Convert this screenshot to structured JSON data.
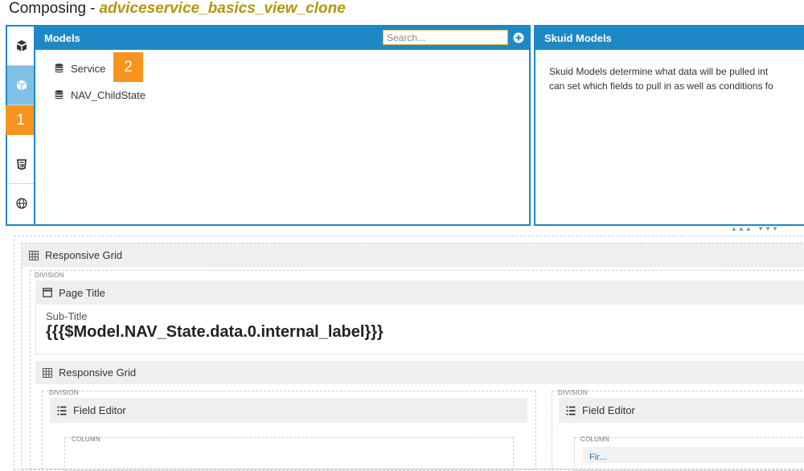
{
  "header": {
    "label": "Composing",
    "separator": "-",
    "page_name": "adviceservice_basics_view_clone"
  },
  "toolbar": {
    "buttons": [
      {
        "icon": "cube-stack-icon",
        "active": false
      },
      {
        "icon": "cube-icon",
        "active": true
      },
      {
        "icon": "css-icon",
        "active": false
      },
      {
        "icon": "globe-icon",
        "active": false
      }
    ],
    "badge_1": "1"
  },
  "models_panel": {
    "title": "Models",
    "search_placeholder": "Search...",
    "badge_2": "2",
    "items": [
      {
        "label": "Service",
        "icon": "database-icon"
      },
      {
        "label": "NAV_ChildState",
        "icon": "database-icon"
      }
    ]
  },
  "info_panel": {
    "title": "Skuid Models",
    "line1": "Skuid Models determine what data will be pulled int",
    "line2": "can set which fields to pull in as well as conditions fo"
  },
  "canvas": {
    "grid1_label": "Responsive Grid",
    "division_label": "DIVISION",
    "page_title_label": "Page Title",
    "subtitle": "Sub-Title",
    "merge_text": "{{{$Model.NAV_State.data.0.internal_label}}}",
    "grid2_label": "Responsive Grid",
    "division_left": "DIVISION",
    "division_right": "DIVISION",
    "field_editor_left": "Field Editor",
    "field_editor_right": "Field Editor",
    "column_left": "COLUMN",
    "column_right": "COLUMN",
    "first_item": "Fir..."
  },
  "colors": {
    "accent": "#1e88c7",
    "badge": "#f7941d",
    "page_name": "#b4960f"
  }
}
